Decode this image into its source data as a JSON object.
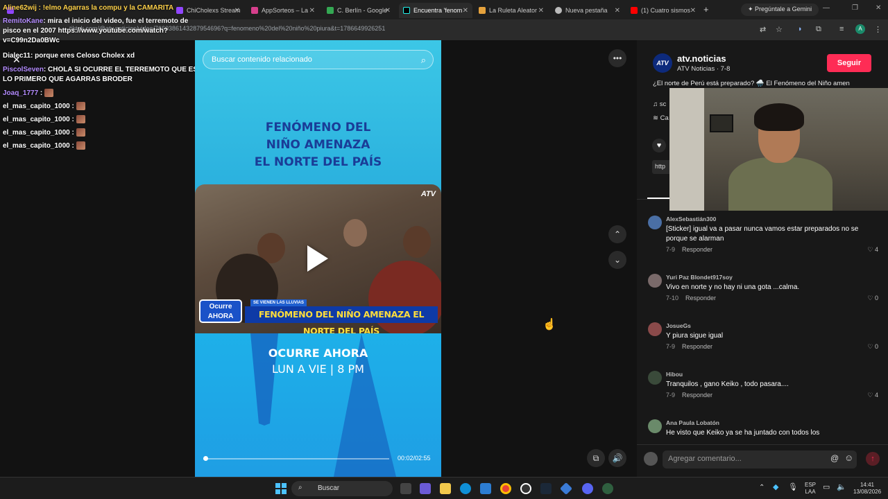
{
  "tabs": [
    {
      "label": "Aline62wij : !elmo Agarras la compu y la CAMARITA"
    },
    {
      "label": "ChiCholexs Stream"
    },
    {
      "label": "AppSorteos – La"
    },
    {
      "label": "C. Berlín - Google"
    },
    {
      "label": "Encuentra 'fenom"
    },
    {
      "label": "La Ruleta Aleator"
    },
    {
      "label": "Nueva pestaña"
    },
    {
      "label": "(1) Cuatro sismos"
    }
  ],
  "gemini_button": "Pregúntale a Gemini",
  "address": {
    "url": "tiktok.com/@atv.noticias/video/7660386143287954696?q=fenomeno%20del%20niño%20piura&t=1786649926251"
  },
  "chat": [
    {
      "user": "RemitoKane",
      "text": ": mira el inicio del video, fue el terremoto de pisco en el 2007 https://www.youtube.com/watch?v=C99n2Da0BWc"
    },
    {
      "user": "Dialec11",
      "text": ": porque eres Celoso Cholex xd"
    },
    {
      "user": "PiscolSeven",
      "text": ": CHOLA SI OCURRE EL TERREMOTO QUE ES LO PRIMERO QUE AGARRAS BRODER"
    },
    {
      "user": "Joaq_1777",
      "text": " :"
    },
    {
      "user": "el_mas_capito_1000",
      "text": " :"
    },
    {
      "user": "el_mas_capito_1000",
      "text": " :"
    },
    {
      "user": "el_mas_capito_1000",
      "text": " :"
    },
    {
      "user": "el_mas_capito_1000",
      "text": " :"
    }
  ],
  "video": {
    "search_placeholder": "Buscar contenido relacionado",
    "headline": [
      "FENÓMENO DEL",
      "NIÑO AMENAZA",
      "EL NORTE DEL PAÍS"
    ],
    "atv_logo": "ATV",
    "banner_tag": "SE VIENEN LAS LLUVIAS",
    "banner": "FENÓMENO DEL NIÑO AMENAZA EL NORTE DEL PAÍS",
    "show_logo": [
      "Ocurre",
      "AHORA"
    ],
    "show_title": "OCURRE AHORA",
    "show_time": "LUN A VIE | 8 PM",
    "timecode": "00:02/02:55",
    "progress": 0.011
  },
  "panel": {
    "avatar_text": "ATV",
    "author": "atv.noticias",
    "author_sub": "ATV Noticias · 7-8",
    "follow_label": "Seguir",
    "description": "¿El norte de Perú está preparado? 🌧️ El Fenómeno del Niño amen",
    "meta1": "sc",
    "meta2": "Ca",
    "link": "http"
  },
  "comments": [
    {
      "user": "AlexSebastián300",
      "text": "[Sticker] igual va a pasar nunca vamos estar preparados no se porque se alarman",
      "date": "7-9",
      "reply": "Responder",
      "likes": "4"
    },
    {
      "user": "Yuri Paz Blondet917soy",
      "text": "Vivo en norte y no hay ni una gota ...calma.",
      "date": "7-10",
      "reply": "Responder",
      "likes": "0"
    },
    {
      "user": "JosueGs",
      "text": "Y piura sigue igual",
      "date": "7-9",
      "reply": "Responder",
      "likes": "0"
    },
    {
      "user": "Hibou",
      "text": "Tranquilos , gano Keiko , todo pasara....",
      "date": "7-9",
      "reply": "Responder",
      "likes": "4"
    },
    {
      "user": "Ana Paula Lobatón",
      "text": "He visto que Keiko ya se ha juntado con todos los",
      "date": "",
      "reply": "",
      "likes": ""
    }
  ],
  "comment_placeholder": "Agregar comentario...",
  "taskbar": {
    "search": "Buscar",
    "lang": "ESP",
    "lang2": "LAA",
    "time": "14:41",
    "date": "13/08/2026"
  }
}
